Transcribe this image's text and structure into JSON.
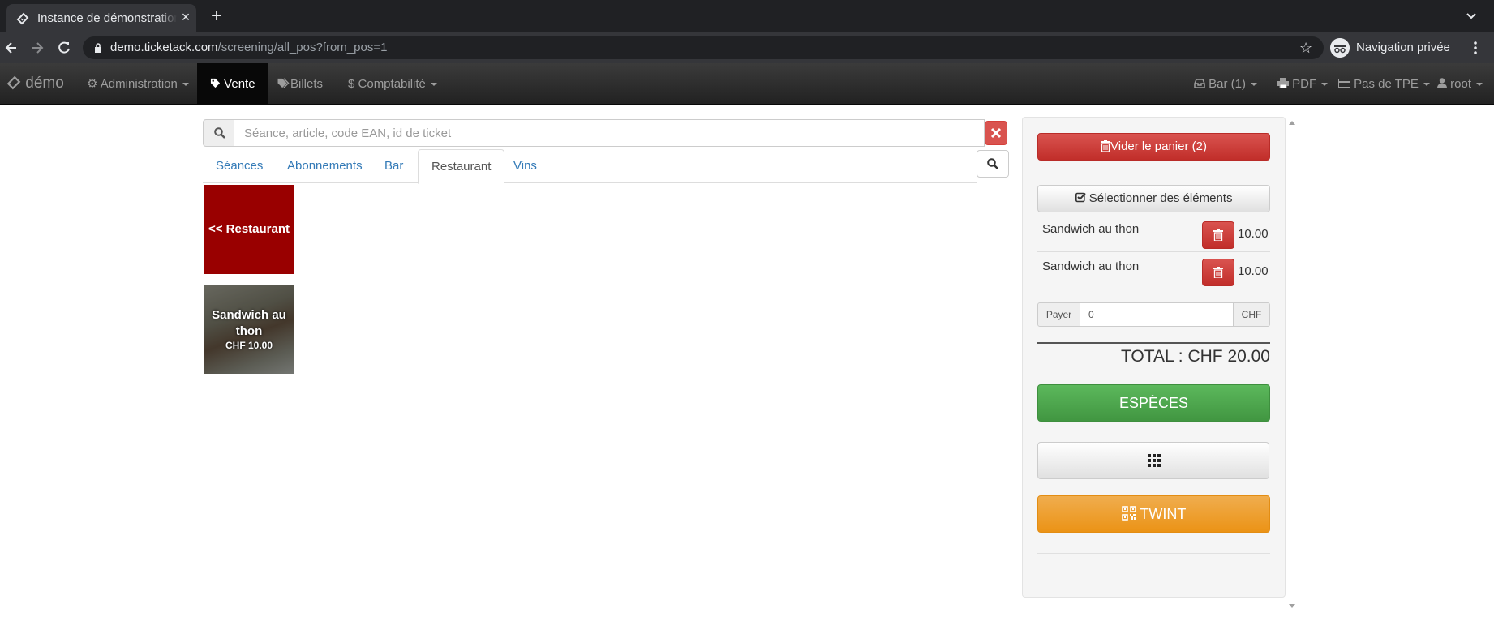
{
  "browser": {
    "tab_title": "Instance de démonstration",
    "url_host": "demo.ticketack.com",
    "url_path": "/screening/all_pos?from_pos=1",
    "incognito_label": "Navigation privée"
  },
  "navbar": {
    "brand": "démo",
    "items": [
      {
        "label": "Administration",
        "icon": "cog-icon"
      },
      {
        "label": "Vente",
        "icon": "tag-icon",
        "active": true
      },
      {
        "label": "Billets",
        "icon": "tags-icon"
      },
      {
        "label": "Comptabilité",
        "icon": "dollar-icon"
      }
    ],
    "right": [
      {
        "label": "Bar (1)",
        "icon": "inbox-icon"
      },
      {
        "label": "PDF",
        "icon": "print-icon"
      },
      {
        "label": "Pas de TPE",
        "icon": "credit-card-icon"
      },
      {
        "label": "root",
        "icon": "user-icon"
      }
    ]
  },
  "search": {
    "placeholder": "Séance, article, code EAN, id de ticket"
  },
  "tabs": [
    {
      "label": "Séances"
    },
    {
      "label": "Abonnements"
    },
    {
      "label": "Bar"
    },
    {
      "label": "Restaurant",
      "active": true
    },
    {
      "label": "Vins"
    }
  ],
  "tiles": {
    "back_label": "<< Restaurant",
    "item_name": "Sandwich au thon",
    "item_price": "CHF 10.00"
  },
  "cart": {
    "empty_label": "Vider le panier (2)",
    "select_label": "Sélectionner des éléments",
    "items": [
      {
        "name": "Sandwich au thon",
        "price": "10.00"
      },
      {
        "name": "Sandwich au thon",
        "price": "10.00"
      }
    ],
    "pay_label": "Payer",
    "pay_value": "0",
    "currency": "CHF",
    "total": "TOTAL : CHF 20.00",
    "cash_label": "ESPÈCES",
    "twint_label": "TWINT"
  },
  "colors": {
    "danger": "#d9534f",
    "success": "#5cb85c",
    "warning": "#f0ad4e",
    "link": "#337ab7",
    "navbar": "#222222",
    "tile_red": "#990000"
  }
}
